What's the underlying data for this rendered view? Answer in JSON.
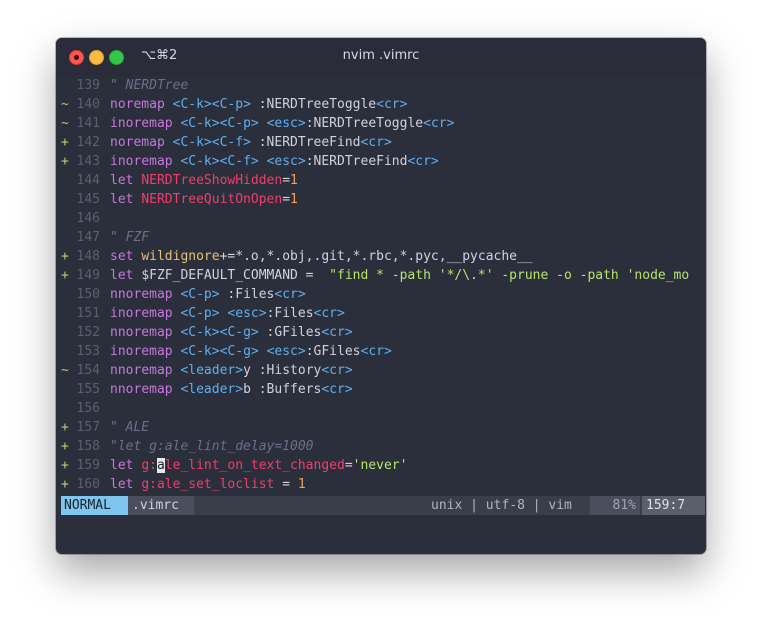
{
  "window": {
    "shortcut": "⌥⌘2",
    "title": "nvim .vimrc"
  },
  "lines": [
    {
      "sign": "",
      "num": "139",
      "segs": [
        {
          "t": "\" NERDTree",
          "c": "comment"
        }
      ]
    },
    {
      "sign": "~",
      "num": "140",
      "segs": [
        {
          "t": "noremap ",
          "c": "kw"
        },
        {
          "t": "<C-k><C-p>",
          "c": "key"
        },
        {
          "t": " :NERDTreeToggle",
          "c": "plain"
        },
        {
          "t": "<cr>",
          "c": "key"
        }
      ]
    },
    {
      "sign": "~",
      "num": "141",
      "segs": [
        {
          "t": "inoremap ",
          "c": "kw"
        },
        {
          "t": "<C-k><C-p>",
          "c": "key"
        },
        {
          "t": " ",
          "c": "plain"
        },
        {
          "t": "<esc>",
          "c": "key"
        },
        {
          "t": ":NERDTreeToggle",
          "c": "plain"
        },
        {
          "t": "<cr>",
          "c": "key"
        }
      ]
    },
    {
      "sign": "+",
      "num": "142",
      "segs": [
        {
          "t": "noremap ",
          "c": "kw"
        },
        {
          "t": "<C-k><C-f>",
          "c": "key"
        },
        {
          "t": " :NERDTreeFind",
          "c": "plain"
        },
        {
          "t": "<cr>",
          "c": "key"
        }
      ]
    },
    {
      "sign": "+",
      "num": "143",
      "segs": [
        {
          "t": "inoremap ",
          "c": "kw"
        },
        {
          "t": "<C-k><C-f>",
          "c": "key"
        },
        {
          "t": " ",
          "c": "plain"
        },
        {
          "t": "<esc>",
          "c": "key"
        },
        {
          "t": ":NERDTreeFind",
          "c": "plain"
        },
        {
          "t": "<cr>",
          "c": "key"
        }
      ]
    },
    {
      "sign": "",
      "num": "144",
      "segs": [
        {
          "t": "let ",
          "c": "kw"
        },
        {
          "t": "NERDTreeShowHidden",
          "c": "red"
        },
        {
          "t": "=",
          "c": "plain"
        },
        {
          "t": "1",
          "c": "num"
        }
      ]
    },
    {
      "sign": "",
      "num": "145",
      "segs": [
        {
          "t": "let ",
          "c": "kw"
        },
        {
          "t": "NERDTreeQuitOnOpen",
          "c": "red"
        },
        {
          "t": "=",
          "c": "plain"
        },
        {
          "t": "1",
          "c": "num"
        }
      ]
    },
    {
      "sign": "",
      "num": "146",
      "segs": []
    },
    {
      "sign": "",
      "num": "147",
      "segs": [
        {
          "t": "\" FZF",
          "c": "comment"
        }
      ]
    },
    {
      "sign": "+",
      "num": "148",
      "segs": [
        {
          "t": "set ",
          "c": "kw"
        },
        {
          "t": "wildignore",
          "c": "yel"
        },
        {
          "t": "+=*.o,*.obj,.git,*.rbc,*.pyc,__pycache__",
          "c": "plain"
        }
      ]
    },
    {
      "sign": "+",
      "num": "149",
      "segs": [
        {
          "t": "let ",
          "c": "kw"
        },
        {
          "t": "$FZF_DEFAULT_COMMAND",
          "c": "plain"
        },
        {
          "t": " = ",
          "c": "plain"
        },
        {
          "t": " \"find * -path '*/\\.*' -prune -o -path 'node_mo",
          "c": "str"
        }
      ]
    },
    {
      "sign": "",
      "num": "150",
      "segs": [
        {
          "t": "nnoremap ",
          "c": "kw"
        },
        {
          "t": "<C-p>",
          "c": "key"
        },
        {
          "t": " :Files",
          "c": "plain"
        },
        {
          "t": "<cr>",
          "c": "key"
        }
      ]
    },
    {
      "sign": "",
      "num": "151",
      "segs": [
        {
          "t": "inoremap ",
          "c": "kw"
        },
        {
          "t": "<C-p>",
          "c": "key"
        },
        {
          "t": " ",
          "c": "plain"
        },
        {
          "t": "<esc>",
          "c": "key"
        },
        {
          "t": ":Files",
          "c": "plain"
        },
        {
          "t": "<cr>",
          "c": "key"
        }
      ]
    },
    {
      "sign": "",
      "num": "152",
      "segs": [
        {
          "t": "nnoremap ",
          "c": "kw"
        },
        {
          "t": "<C-k><C-g>",
          "c": "key"
        },
        {
          "t": " :GFiles",
          "c": "plain"
        },
        {
          "t": "<cr>",
          "c": "key"
        }
      ]
    },
    {
      "sign": "",
      "num": "153",
      "segs": [
        {
          "t": "inoremap ",
          "c": "kw"
        },
        {
          "t": "<C-k><C-g>",
          "c": "key"
        },
        {
          "t": " ",
          "c": "plain"
        },
        {
          "t": "<esc>",
          "c": "key"
        },
        {
          "t": ":GFiles",
          "c": "plain"
        },
        {
          "t": "<cr>",
          "c": "key"
        }
      ]
    },
    {
      "sign": "~",
      "num": "154",
      "segs": [
        {
          "t": "nnoremap ",
          "c": "kw"
        },
        {
          "t": "<leader>",
          "c": "key"
        },
        {
          "t": "y :History",
          "c": "plain"
        },
        {
          "t": "<cr>",
          "c": "key"
        }
      ]
    },
    {
      "sign": "",
      "num": "155",
      "segs": [
        {
          "t": "nnoremap ",
          "c": "kw"
        },
        {
          "t": "<leader>",
          "c": "key"
        },
        {
          "t": "b :Buffers",
          "c": "plain"
        },
        {
          "t": "<cr>",
          "c": "key"
        }
      ]
    },
    {
      "sign": "",
      "num": "156",
      "segs": []
    },
    {
      "sign": "+",
      "num": "157",
      "segs": [
        {
          "t": "\" ALE",
          "c": "comment"
        }
      ]
    },
    {
      "sign": "+",
      "num": "158",
      "segs": [
        {
          "t": "\"let g:ale_lint_delay=1000",
          "c": "comment"
        }
      ]
    },
    {
      "sign": "+",
      "num": "159",
      "segs": [
        {
          "t": "let ",
          "c": "kw"
        },
        {
          "t": "g:",
          "c": "red"
        },
        {
          "t": "a",
          "c": "cursor"
        },
        {
          "t": "le_lint_on_text_changed",
          "c": "red"
        },
        {
          "t": "=",
          "c": "plain"
        },
        {
          "t": "'never'",
          "c": "str"
        }
      ]
    },
    {
      "sign": "+",
      "num": "160",
      "segs": [
        {
          "t": "let ",
          "c": "kw"
        },
        {
          "t": "g:ale_set_loclist",
          "c": "red"
        },
        {
          "t": " = ",
          "c": "plain"
        },
        {
          "t": "1",
          "c": "num"
        }
      ]
    }
  ],
  "status": {
    "mode": "NORMAL",
    "file": ".vimrc",
    "info": "unix | utf-8 | vim",
    "percent": "81%",
    "position": "159:7"
  },
  "colors": {
    "background": "#2b2e3b",
    "keyword": "#c678dd",
    "key_notation": "#61afef",
    "variable": "#ef3f6b",
    "string": "#b6e36e",
    "number": "#f2a25e",
    "mode_badge": "#7ec6ee"
  }
}
